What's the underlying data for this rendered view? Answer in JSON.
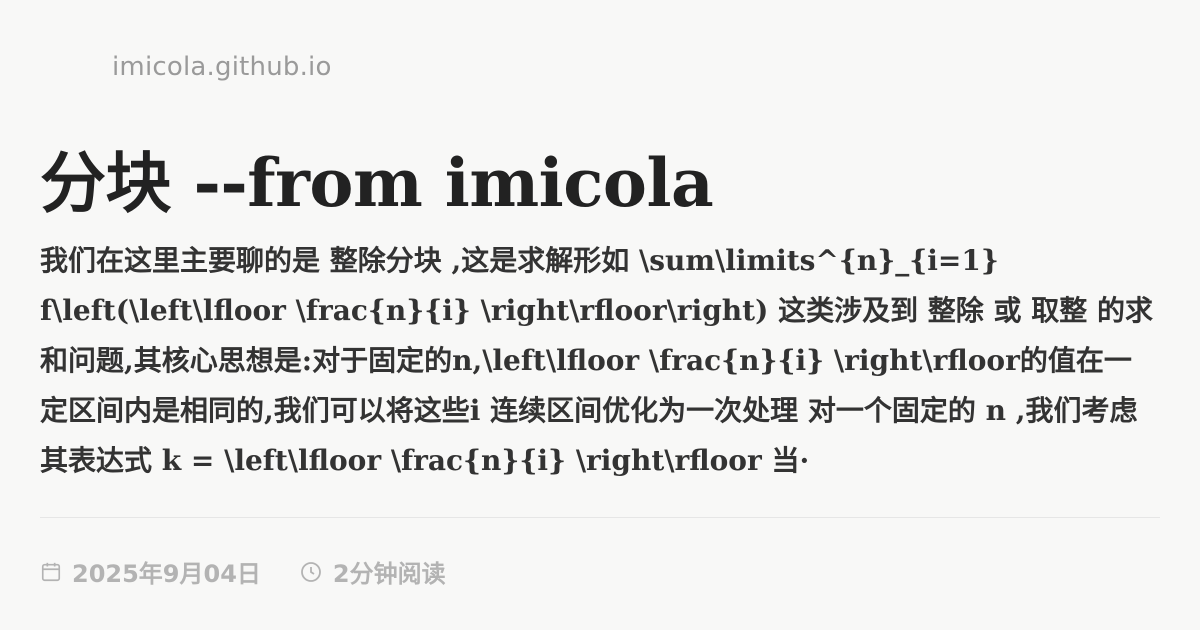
{
  "site": {
    "domain": "imicola.github.io"
  },
  "post": {
    "title": "分块 --from imicola",
    "excerpt": "我们在这里主要聊的是 整除分块 ,这是求解形如 \\sum\\limits^{n}_{i=1} f\\left(\\left\\lfloor \\frac{n}{i} \\right\\rfloor\\right) 这类涉及到 整除 或 取整 的求和问题,其核心思想是:对于固定的n,\\left\\lfloor \\frac{n}{i} \\right\\rfloor的值在一定区间内是相同的,我们可以将这些i 连续区间优化为一次处理 对一个固定的 n ,我们考虑其表达式 k = \\left\\lfloor \\frac{n}{i} \\right\\rfloor 当·",
    "date": "2025年9月04日",
    "read_time": "2分钟阅读"
  },
  "icons": {
    "date": "calendar-icon",
    "read_time": "clock-icon"
  }
}
